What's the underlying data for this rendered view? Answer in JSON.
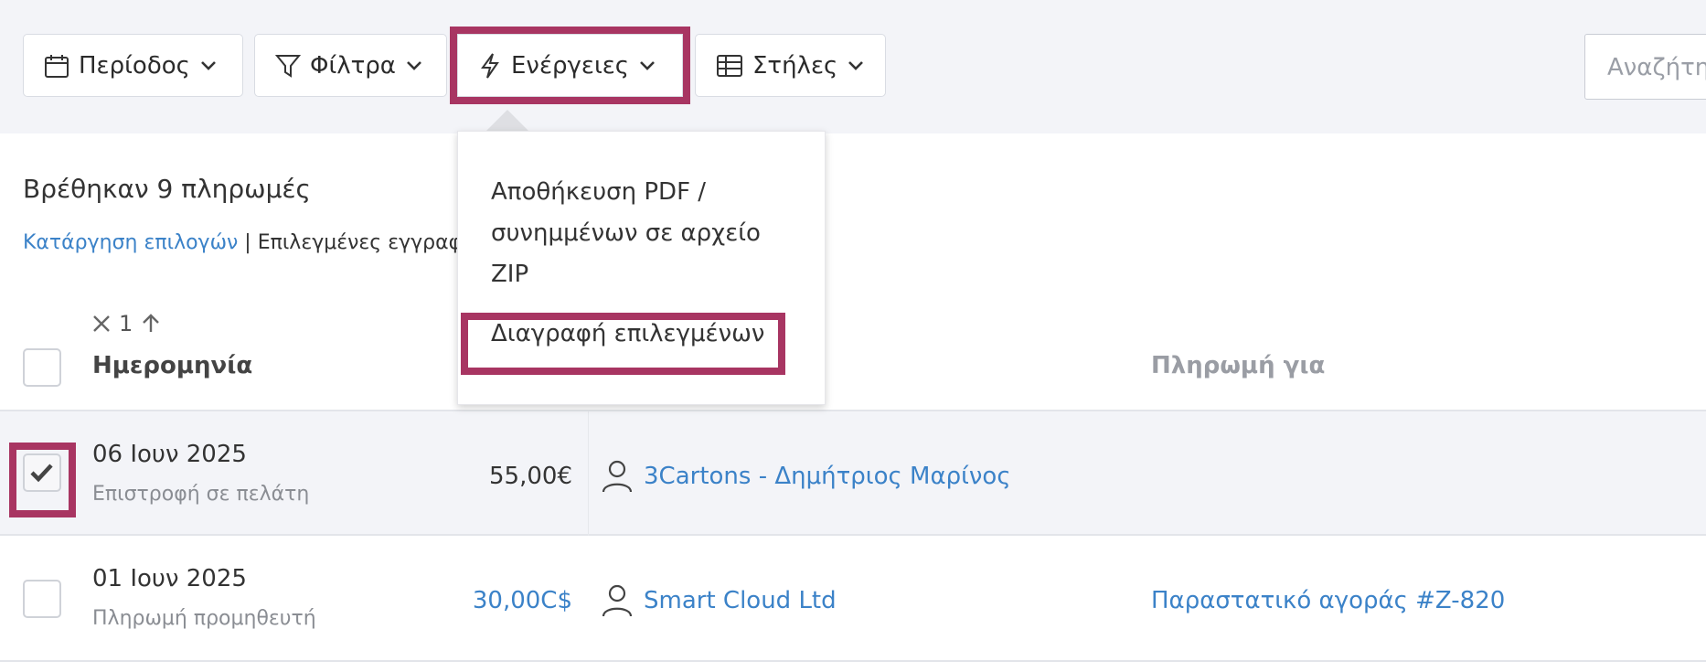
{
  "toolbar": {
    "period_label": "Περίοδος",
    "filters_label": "Φίλτρα",
    "actions_label": "Ενέργειες",
    "columns_label": "Στήλες",
    "search_placeholder": "Αναζήτηση"
  },
  "actions_menu": {
    "items": [
      {
        "label": "Αποθήκευση PDF / συνημμένων σε αρχείο ZIP"
      },
      {
        "label": "Διαγραφή επιλεγμένων"
      }
    ]
  },
  "results": {
    "count_text": "Βρέθηκαν 9 πληρωμές",
    "clear_selection": "Κατάργηση επιλογών",
    "separator": "|",
    "selected_records": "Επιλεγμένες εγγραφ"
  },
  "table": {
    "sort_index": "1",
    "columns": {
      "date": "Ημερομηνία",
      "payment_for": "Πληρωμή για"
    },
    "rows": [
      {
        "date": "06 Ιουν 2025",
        "type": "Επιστροφή σε πελάτη",
        "amount": "55,00€",
        "amount_color": "#333333",
        "party": "3Cartons - Δημήτριος Μαρίνος",
        "payment_for": "",
        "checked": true
      },
      {
        "date": "01 Ιουν 2025",
        "type": "Πληρωμή προμηθευτή",
        "amount": "30,00C$",
        "amount_color": "#3b82c8",
        "party": "Smart Cloud Ltd",
        "payment_for": "Παραστατικό αγοράς #Z-820",
        "checked": false
      }
    ]
  },
  "colors": {
    "highlight": "#a83562",
    "link": "#3b82c8",
    "toolbar_bg": "#f3f4f8"
  }
}
